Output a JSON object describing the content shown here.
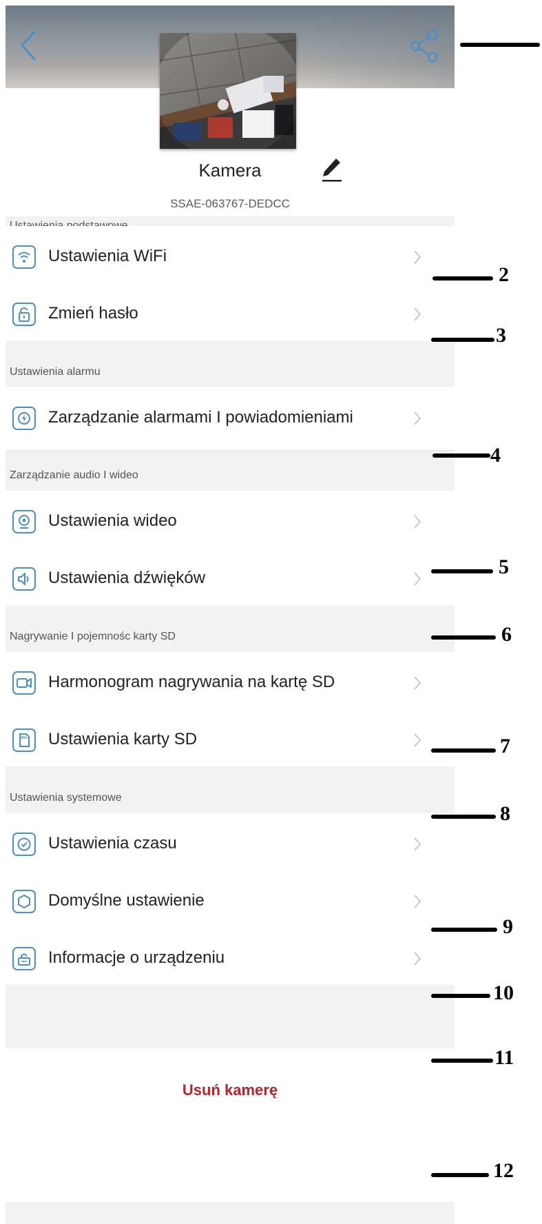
{
  "header": {
    "device_name": "Kamera",
    "device_id": "SSAE-063767-DEDCC"
  },
  "icons": {
    "back": "chevron-left-icon",
    "share": "share-icon",
    "edit": "pencil-icon"
  },
  "sections": [
    {
      "title": "Ustawienia podstawowe",
      "items": [
        {
          "label": "Ustawienia WiFi",
          "icon": "wifi-icon"
        },
        {
          "label": "Zmień hasło",
          "icon": "lock-icon"
        }
      ]
    },
    {
      "title": "Ustawienia alarmu",
      "items": [
        {
          "label": "Zarządzanie alarmami I powiadomieniami",
          "icon": "alarm-icon"
        }
      ]
    },
    {
      "title": "Zarządzanie audio I wideo",
      "items": [
        {
          "label": "Ustawienia wideo",
          "icon": "webcam-icon"
        },
        {
          "label": "Ustawienia dźwięków",
          "icon": "speaker-icon"
        }
      ]
    },
    {
      "title": "Nagrywanie I pojemnośc karty SD",
      "items": [
        {
          "label": "Harmonogram nagrywania na kartę SD",
          "icon": "video-record-icon"
        },
        {
          "label": "Ustawienia karty SD",
          "icon": "sd-card-icon"
        }
      ]
    },
    {
      "title": "Ustawienia systemowe",
      "items": [
        {
          "label": "Ustawienia czasu",
          "icon": "clock-icon"
        },
        {
          "label": "Domyślne ustawienie",
          "icon": "reset-icon"
        },
        {
          "label": "Informacje o urządzeniu",
          "icon": "device-info-icon"
        }
      ]
    }
  ],
  "delete_label": "Usuń kamerę",
  "callouts": [
    "2",
    "3",
    "4",
    "5",
    "6",
    "7",
    "8",
    "9",
    "10",
    "11",
    "12"
  ],
  "colors": {
    "accent": "#4a90c8",
    "danger": "#b3262d",
    "section_bg": "#f2f2f2"
  }
}
